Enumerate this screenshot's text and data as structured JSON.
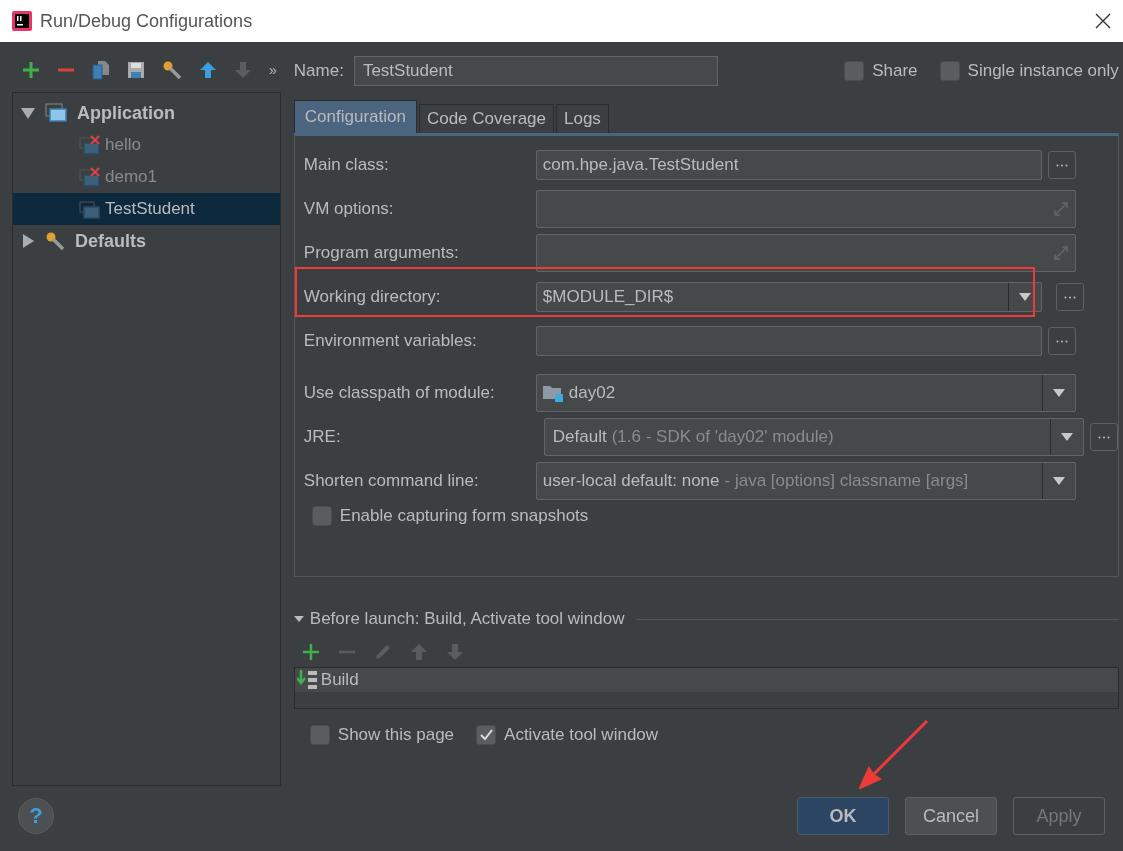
{
  "window": {
    "title": "Run/Debug Configurations"
  },
  "sidebar": {
    "more": "»",
    "tree": [
      {
        "label": "Application",
        "kind": "folder",
        "expanded": true,
        "selected": false,
        "children": [
          {
            "label": "hello",
            "error": true,
            "selected": false
          },
          {
            "label": "demo1",
            "error": true,
            "selected": false
          },
          {
            "label": "TestStudent",
            "error": false,
            "selected": true
          }
        ]
      },
      {
        "label": "Defaults",
        "kind": "defaults",
        "expanded": false,
        "selected": false
      }
    ]
  },
  "name": {
    "label": "Name:",
    "value": "TestStudent"
  },
  "options": [
    {
      "label": "Share",
      "checked": false
    },
    {
      "label": "Single instance only",
      "checked": false
    }
  ],
  "tabs": [
    {
      "label": "Configuration",
      "selected": true
    },
    {
      "label": "Code Coverage",
      "selected": false
    },
    {
      "label": "Logs",
      "selected": false
    }
  ],
  "form": [
    {
      "kind": "text",
      "label": "Main class:",
      "value": "com.hpe.java.TestStudent",
      "highlighted": false
    },
    {
      "kind": "expand",
      "label": "VM options:",
      "highlighted": false
    },
    {
      "kind": "expand",
      "label": "Program arguments:",
      "highlighted": false
    },
    {
      "kind": "combo",
      "label": "Working directory:",
      "value": "$MODULE_DIR$",
      "highlighted": true
    },
    {
      "kind": "text",
      "label": "Environment variables:",
      "highlighted": false
    },
    {
      "kind": "module",
      "label": "Use classpath of module:",
      "value": "day02",
      "highlighted": false
    },
    {
      "kind": "jre",
      "label": "JRE:",
      "value": "Default",
      "detail": "(1.6 - SDK of 'day02' module)",
      "highlighted": false
    },
    {
      "kind": "select",
      "label": "Shorten command line:",
      "value": "user-local default: none",
      "detail": "- java [options] classname [args]",
      "highlighted": false
    }
  ],
  "snapshots": {
    "label": "Enable capturing form snapshots",
    "checked": false
  },
  "before_launch": {
    "title": "Before launch: Build, Activate tool window",
    "expanded": true,
    "tasks": [
      {
        "label": "Build"
      }
    ]
  },
  "launch_options": [
    {
      "label": "Show this page",
      "checked": false
    },
    {
      "label": "Activate tool window",
      "checked": true
    }
  ],
  "help": "?",
  "buttons": [
    {
      "label": "OK",
      "kind": "default",
      "callout_arrow": true
    },
    {
      "label": "Cancel",
      "kind": "normal"
    },
    {
      "label": "Apply",
      "kind": "disabled"
    }
  ]
}
